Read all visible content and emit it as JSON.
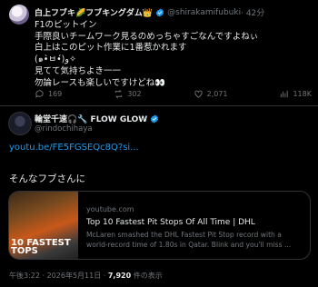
{
  "reply_tweet": {
    "display_name": "白上フブキ🌽フブキングダム👑",
    "handle": "@shirakamifubuki",
    "time": "· 42分",
    "lines": [
      "F1のピットイン",
      "手際良いチームワーク見るのめっちゃすごなんですよねぃ",
      "白上はこのピット作業に1番惹かれます",
      "(๑•̀ㅂ•́)و✧",
      "見てて気持ちよき一一",
      "勿論レースも楽しいですけどね👀"
    ],
    "stats": {
      "replies": "169",
      "reposts": "302",
      "likes": "2,071",
      "views": "118K"
    }
  },
  "main_tweet": {
    "display_name": "輪堂千速🎧🔧 FLOW GLOW",
    "handle": "@rindochihaya",
    "link_text": "youtu.be/FE5FGSEQc8Q?si...",
    "quote_text": "そんなフブさんに",
    "card": {
      "domain": "youtube.com",
      "title": "Top 10 Fastest Pit Stops Of All Time | DHL",
      "description_line1": "McLaren smashed the DHL Fastest Pit Stop record with a",
      "description_line2": "world-record time of 1.80s in Qatar. Blink and you'll miss ...",
      "thumb_caption_line1": "10 FASTEST",
      "thumb_caption_line2": "TOPS"
    },
    "timestamp": "午後3:22 · 2026年5月11日 · ",
    "view_count": "7,920",
    "view_suffix": " 件の表示"
  },
  "colors": {
    "background": "#000000",
    "text": "#e7e9ea",
    "muted": "#71767b",
    "link": "#1d9bf0",
    "verified": "#1d9bf0",
    "border": "#2f3336"
  }
}
